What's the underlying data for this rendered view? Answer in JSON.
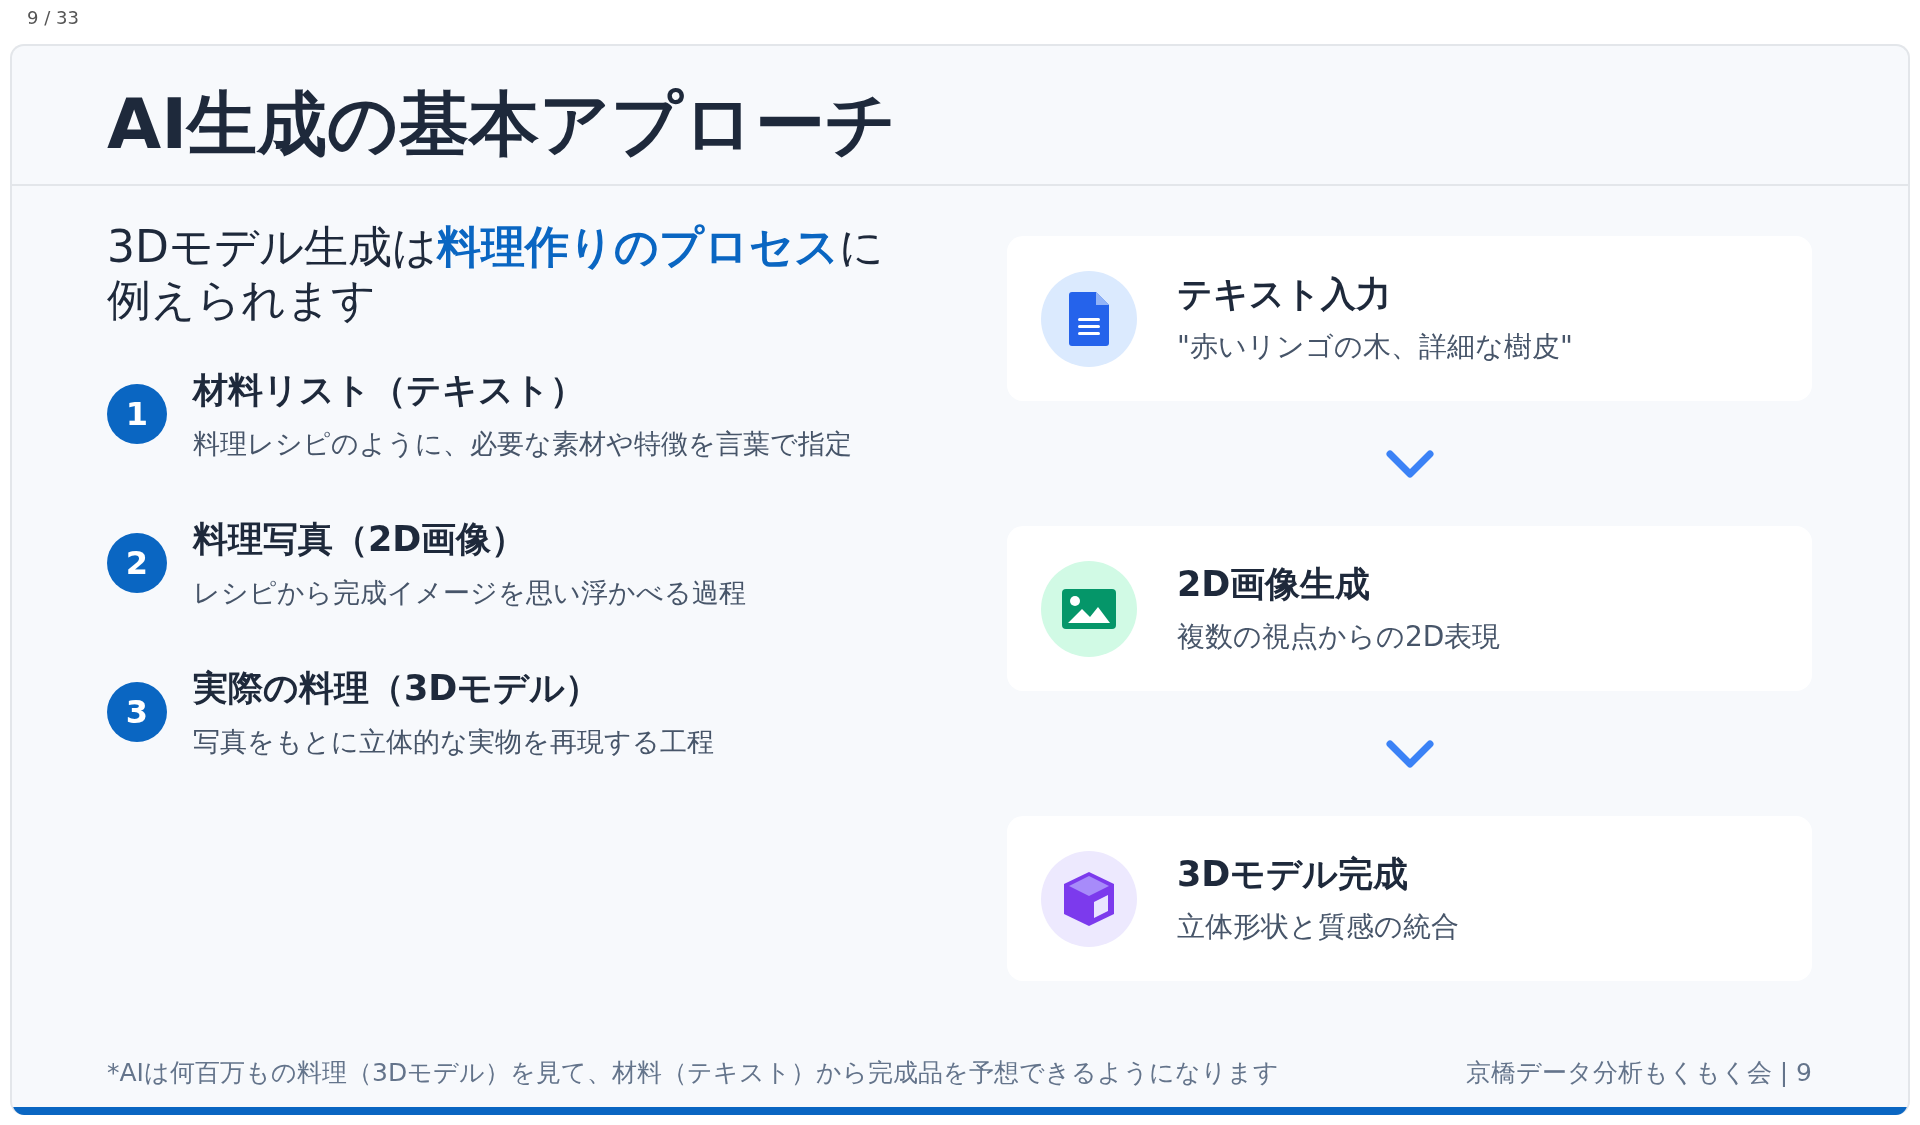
{
  "viewer": {
    "page_counter": "9 / 33"
  },
  "slide": {
    "title": "AI生成の基本アプローチ",
    "intro": "3Dモデル生成は**料理作りのプロセス**に例えられます",
    "steps": [
      {
        "number": "1",
        "title": "材料リスト（テキスト）",
        "description": "料理レシピのように、必要な素材や特徴を言葉で指定"
      },
      {
        "number": "2",
        "title": "料理写真（2D画像）",
        "description": "レシピから完成イメージを思い浮かべる過程"
      },
      {
        "number": "3",
        "title": "実際の料理（3Dモデル）",
        "description": "写真をもとに立体的な実物を再現する工程"
      }
    ],
    "flow": [
      {
        "kind": "document",
        "title": "テキスト入力",
        "description": "\"赤いリンゴの木、詳細な樹皮\"",
        "color": "#2563eb"
      },
      {
        "kind": "image",
        "title": "2D画像生成",
        "description": "複数の視点からの2D表現",
        "color": "#059669"
      },
      {
        "kind": "cube",
        "title": "3Dモデル完成",
        "description": "立体形状と質感の統合",
        "color": "#7c3aed"
      }
    ],
    "footnote": "*AIは何百万もの料理（3Dモデル）を見て、材料（テキスト）から完成品を予想できるようになります",
    "footer_credit": "京橋データ分析もくもく会 | 9"
  }
}
